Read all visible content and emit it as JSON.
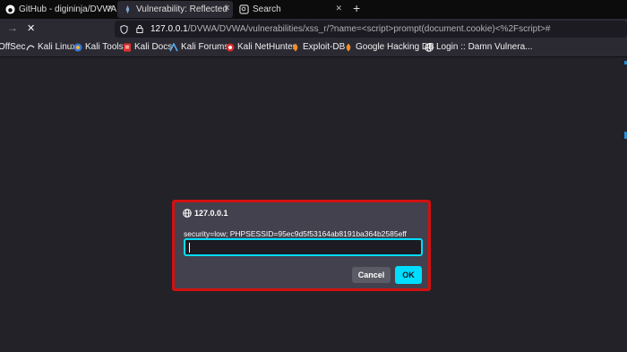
{
  "tabs": [
    {
      "label": "GitHub - digininja/DVWA",
      "icon": "github-icon"
    },
    {
      "label": "Vulnerability: Reflected C",
      "icon": "dvwa-icon",
      "active": true
    },
    {
      "label": "Search",
      "icon": "search-icon"
    }
  ],
  "tab_close": "✕",
  "new_tab": "+",
  "nav": {
    "back": "←",
    "forward": "→",
    "stop": "✕"
  },
  "url": {
    "host": "127.0.0.1",
    "path": "/DVWA/DVWA/vulnerabilities/xss_r/?name=<script>prompt(document.cookie)<%2Fscript>#"
  },
  "bookmarks": [
    {
      "label": "OffSec",
      "icon": "offsec-icon"
    },
    {
      "label": "Kali Linux",
      "icon": "kali-icon"
    },
    {
      "label": "Kali Tools",
      "icon": "kali-tools-icon"
    },
    {
      "label": "Kali Docs",
      "icon": "kali-docs-icon"
    },
    {
      "label": "Kali Forums",
      "icon": "kali-forums-icon"
    },
    {
      "label": "Kali NetHunter",
      "icon": "nethunter-icon"
    },
    {
      "label": "Exploit-DB",
      "icon": "exploit-db-icon"
    },
    {
      "label": "Google Hacking DB",
      "icon": "ghdb-icon"
    },
    {
      "label": "Login :: Damn Vulnera...",
      "icon": "globe-icon"
    }
  ],
  "dialog": {
    "origin": "127.0.0.1",
    "message": "security=low; PHPSESSID=95ec9d5f53164ab8191ba364b2585eff",
    "input_value": "",
    "cancel_label": "Cancel",
    "ok_label": "OK"
  },
  "colors": {
    "accent": "#00ddff",
    "highlight_border": "#d31010",
    "dialog_bg": "#42414d",
    "page_bg": "#232228"
  }
}
